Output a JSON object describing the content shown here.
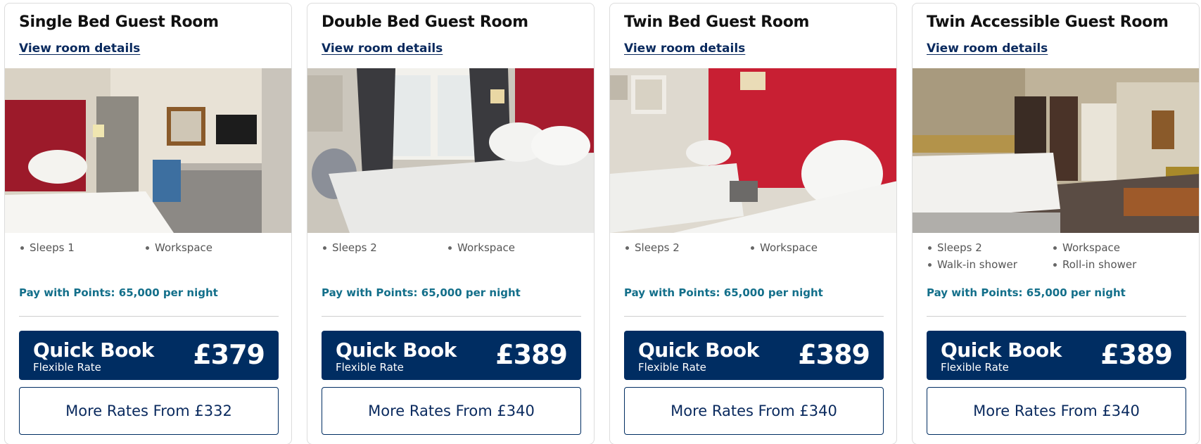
{
  "rooms": [
    {
      "title": "Single Bed Guest Room",
      "details_link": "View room details",
      "amenities": [
        "Sleeps 1",
        "Workspace"
      ],
      "points": "Pay with Points: 65,000 per night",
      "quick_book": {
        "label": "Quick Book",
        "rate": "Flexible Rate",
        "price": "£379"
      },
      "more_rates": "More Rates From £332"
    },
    {
      "title": "Double Bed Guest Room",
      "details_link": "View room details",
      "amenities": [
        "Sleeps 2",
        "Workspace"
      ],
      "points": "Pay with Points: 65,000 per night",
      "quick_book": {
        "label": "Quick Book",
        "rate": "Flexible Rate",
        "price": "£389"
      },
      "more_rates": "More Rates From £340"
    },
    {
      "title": "Twin Bed Guest Room",
      "details_link": "View room details",
      "amenities": [
        "Sleeps 2",
        "Workspace"
      ],
      "points": "Pay with Points: 65,000 per night",
      "quick_book": {
        "label": "Quick Book",
        "rate": "Flexible Rate",
        "price": "£389"
      },
      "more_rates": "More Rates From £340"
    },
    {
      "title": "Twin Accessible Guest Room",
      "details_link": "View room details",
      "amenities": [
        "Sleeps 2",
        "Workspace",
        "Walk-in shower",
        "Roll-in shower"
      ],
      "points": "Pay with Points: 65,000 per night",
      "quick_book": {
        "label": "Quick Book",
        "rate": "Flexible Rate",
        "price": "£389"
      },
      "more_rates": "More Rates From £340"
    }
  ],
  "colors": {
    "primary_navy": "#002d62",
    "points_teal": "#136f8a",
    "headboard_red": "#b01a2c"
  }
}
